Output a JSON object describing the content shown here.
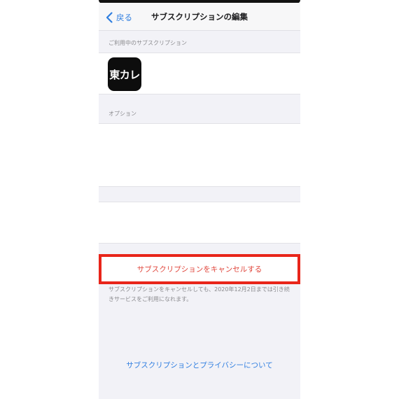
{
  "nav": {
    "back_label": "戻る",
    "title": "サブスクリプションの編集"
  },
  "sections": {
    "current_header": "ご利用中のサブスクリプション",
    "options_header": "オプション"
  },
  "app": {
    "icon_text": "東カレ"
  },
  "actions": {
    "cancel_label": "サブスクリプションをキャンセルする"
  },
  "footnote": "サブスクリプションをキャンセルしても、2020年12月2日までは引き続きサービスをご利用になれます。",
  "links": {
    "privacy_label": "サブスクリプションとプライバシーについて"
  },
  "colors": {
    "accent": "#2f7ee0",
    "cancel_text": "#e0463c",
    "highlight_border": "#e8251a",
    "background": "#f2f2f7"
  },
  "icons": {
    "back": "chevron-left-icon"
  }
}
